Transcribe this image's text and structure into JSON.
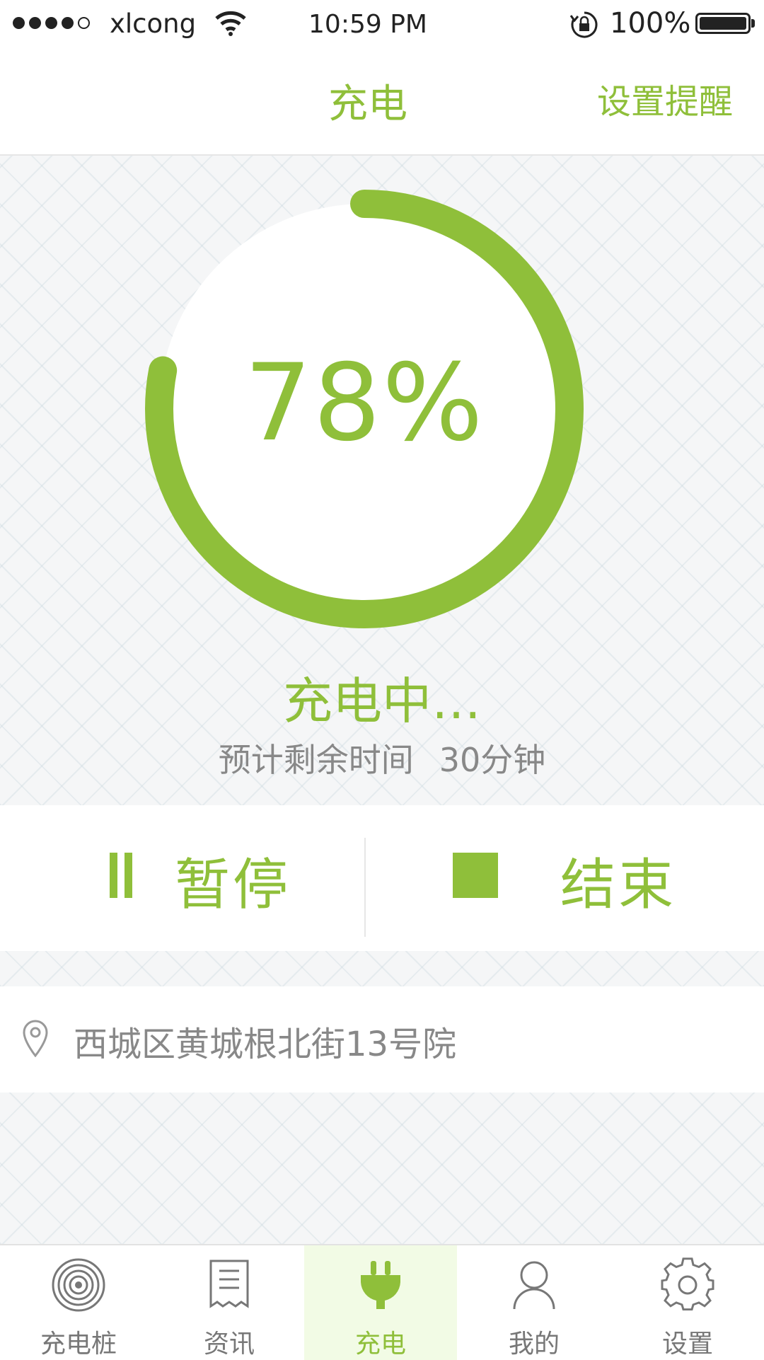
{
  "status_bar": {
    "carrier": "xlcong",
    "time": "10:59 PM",
    "battery": "100%"
  },
  "nav": {
    "title": "充电",
    "right_action": "设置提醒"
  },
  "charging": {
    "percent_label": "78%",
    "progress": 0.78,
    "status": "充电中…",
    "remaining_label": "预计剩余时间",
    "remaining_value": "30分钟"
  },
  "controls": {
    "pause_label": "暂停",
    "stop_label": "结束"
  },
  "location": {
    "address": "西城区黄城根北街13号院"
  },
  "tabs": [
    {
      "label": "充电桩",
      "icon": "charging-pile-icon"
    },
    {
      "label": "资讯",
      "icon": "news-icon"
    },
    {
      "label": "充电",
      "icon": "plug-icon",
      "active": true
    },
    {
      "label": "我的",
      "icon": "user-icon"
    },
    {
      "label": "设置",
      "icon": "gear-icon"
    }
  ],
  "colors": {
    "accent": "#8fbf3a",
    "muted_text": "#888888",
    "active_tab_bg": "#f2fbe5"
  }
}
